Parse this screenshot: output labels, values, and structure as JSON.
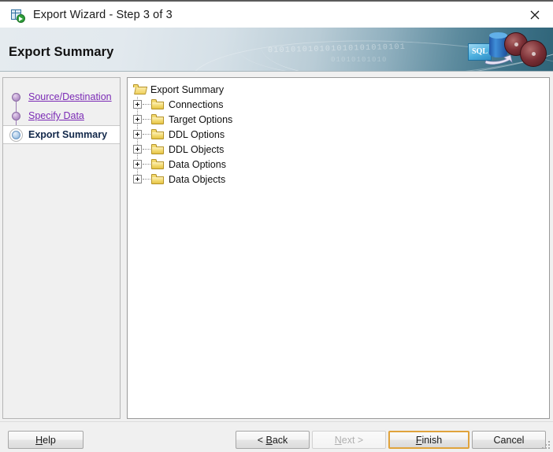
{
  "window": {
    "title": "Export Wizard - Step 3 of 3",
    "icon": "export-table-icon",
    "close_label": "×"
  },
  "banner": {
    "heading": "Export Summary",
    "binary_text_1": "010101010101010101010101",
    "binary_text_2": "01010101010",
    "artwork_label": "SQL",
    "accent_color": "#2f6478",
    "light_color": "#e5ebef"
  },
  "sidebar": {
    "steps": [
      {
        "label": "Source/Destination",
        "state": "completed"
      },
      {
        "label": "Specify Data",
        "state": "completed"
      },
      {
        "label": "Export Summary",
        "state": "current"
      }
    ],
    "link_color": "#7b2bb5",
    "current_color": "#12284a"
  },
  "tree": {
    "root": {
      "label": "Export Summary",
      "icon": "folder-open-icon",
      "expanded": true
    },
    "nodes": [
      {
        "label": "Connections",
        "icon": "folder-icon",
        "expander": "plus"
      },
      {
        "label": "Target Options",
        "icon": "folder-icon",
        "expander": "plus"
      },
      {
        "label": "DDL Options",
        "icon": "folder-icon",
        "expander": "plus"
      },
      {
        "label": "DDL Objects",
        "icon": "folder-icon",
        "expander": "plus"
      },
      {
        "label": "Data Options",
        "icon": "folder-icon",
        "expander": "plus"
      },
      {
        "label": "Data Objects",
        "icon": "folder-icon",
        "expander": "plus"
      }
    ]
  },
  "footer": {
    "help": {
      "pre": "",
      "accel": "H",
      "post": "elp",
      "state": "enabled"
    },
    "back": {
      "pre": "< ",
      "accel": "B",
      "post": "ack",
      "state": "enabled"
    },
    "next": {
      "pre": "",
      "accel": "N",
      "post": "ext >",
      "state": "disabled"
    },
    "finish": {
      "pre": "",
      "accel": "F",
      "post": "inish",
      "state": "default"
    },
    "cancel": {
      "pre": "",
      "accel": "",
      "post": "Cancel",
      "state": "enabled"
    }
  }
}
